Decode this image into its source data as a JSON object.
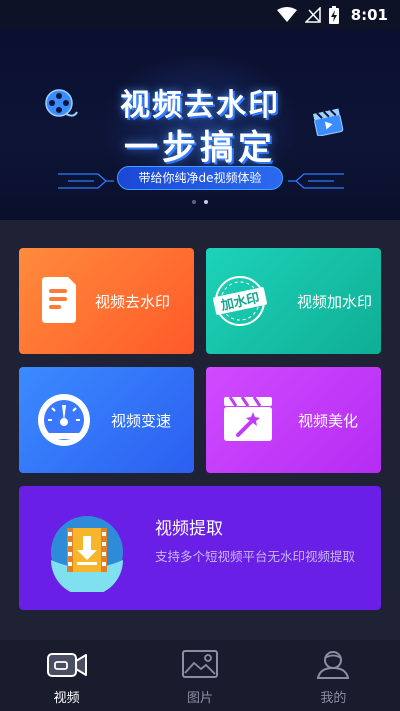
{
  "status_bar": {
    "time": "8:01"
  },
  "banner": {
    "title_line1": "视频去水印",
    "title_line2": "一步搞定",
    "tagline": "带给你纯净de视频体验"
  },
  "cards": {
    "remove_watermark": "视频去水印",
    "add_watermark": "视频加水印",
    "add_watermark_stamp": "加水印",
    "speed": "视频变速",
    "beautify": "视频美化",
    "extract_title": "视频提取",
    "extract_desc": "支持多个短视频平台无水印视频提取"
  },
  "nav": {
    "items": [
      {
        "label": "视频",
        "icon": "video-icon",
        "active": true
      },
      {
        "label": "图片",
        "icon": "image-icon",
        "active": false
      },
      {
        "label": "我的",
        "icon": "profile-icon",
        "active": false
      }
    ]
  },
  "colors": {
    "remove_card": "#ff6a2e",
    "add_card": "#14c2a7",
    "speed_card": "#336ff6",
    "beauty_card": "#c03cf8",
    "extract_card": "#6a1fe6",
    "background": "#1f2235"
  }
}
